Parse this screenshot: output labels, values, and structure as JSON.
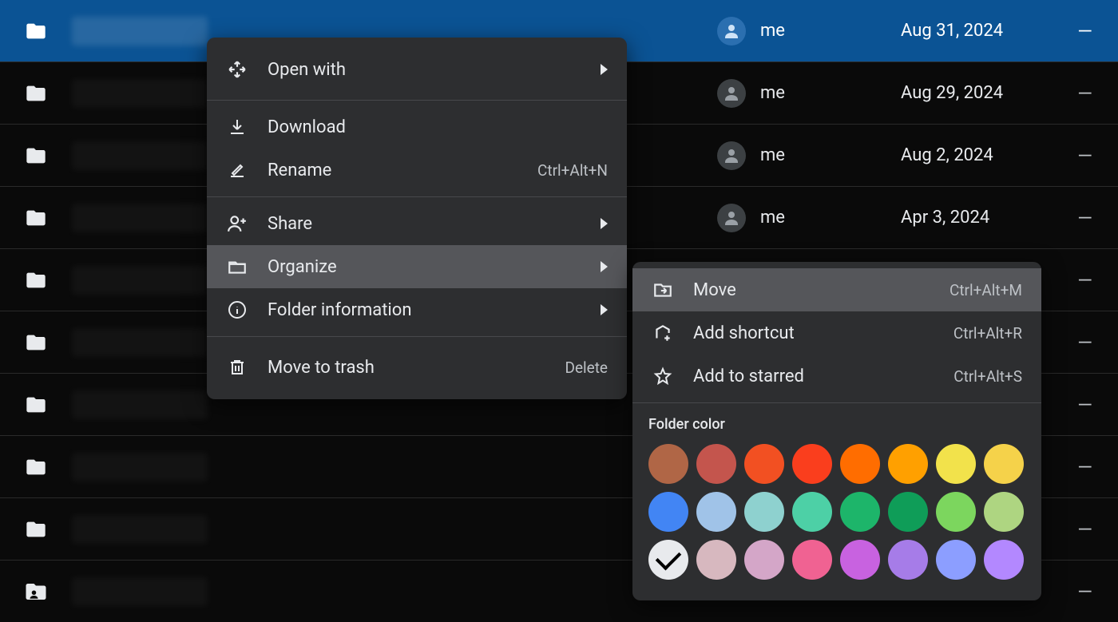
{
  "rows": [
    {
      "owner": "me",
      "date": "Aug 31, 2024",
      "selected": true,
      "shared": false
    },
    {
      "owner": "me",
      "date": "Aug 29, 2024",
      "selected": false,
      "shared": false
    },
    {
      "owner": "me",
      "date": "Aug 2, 2024",
      "selected": false,
      "shared": false
    },
    {
      "owner": "me",
      "date": "Apr 3, 2024",
      "selected": false,
      "shared": false
    },
    {
      "owner": "",
      "date": "",
      "selected": false,
      "shared": false
    },
    {
      "owner": "",
      "date": "",
      "selected": false,
      "shared": false
    },
    {
      "owner": "",
      "date": "",
      "selected": false,
      "shared": false
    },
    {
      "owner": "",
      "date": "",
      "selected": false,
      "shared": false
    },
    {
      "owner": "",
      "date": "",
      "selected": false,
      "shared": false
    },
    {
      "owner": "",
      "date": "",
      "selected": false,
      "shared": true
    }
  ],
  "dash": "—",
  "menu1": {
    "open_with": "Open with",
    "download": "Download",
    "rename": "Rename",
    "rename_shortcut": "Ctrl+Alt+N",
    "share": "Share",
    "organize": "Organize",
    "folder_info": "Folder information",
    "trash": "Move to trash",
    "trash_shortcut": "Delete"
  },
  "menu2": {
    "move": "Move",
    "move_shortcut": "Ctrl+Alt+M",
    "shortcut": "Add shortcut",
    "shortcut_kb": "Ctrl+Alt+R",
    "starred": "Add to starred",
    "starred_kb": "Ctrl+Alt+S",
    "folder_color": "Folder color"
  },
  "colors": [
    {
      "hex": "#b06646",
      "selected": false
    },
    {
      "hex": "#c4554d",
      "selected": false
    },
    {
      "hex": "#f25022",
      "selected": false
    },
    {
      "hex": "#fa3e1d",
      "selected": false
    },
    {
      "hex": "#ff6d00",
      "selected": false
    },
    {
      "hex": "#ffa000",
      "selected": false
    },
    {
      "hex": "#f2e24b",
      "selected": false
    },
    {
      "hex": "#f5d24a",
      "selected": false
    },
    {
      "hex": "#4285f4",
      "selected": false
    },
    {
      "hex": "#a0c3e8",
      "selected": false
    },
    {
      "hex": "#8ed1cf",
      "selected": false
    },
    {
      "hex": "#4dd0a6",
      "selected": false
    },
    {
      "hex": "#1db56a",
      "selected": false
    },
    {
      "hex": "#0f9d58",
      "selected": false
    },
    {
      "hex": "#7cd65e",
      "selected": false
    },
    {
      "hex": "#aed581",
      "selected": false
    },
    {
      "hex": "#e8eaed",
      "selected": true
    },
    {
      "hex": "#d7b8bf",
      "selected": false
    },
    {
      "hex": "#d4a6c8",
      "selected": false
    },
    {
      "hex": "#f06292",
      "selected": false
    },
    {
      "hex": "#c862e0",
      "selected": false
    },
    {
      "hex": "#a67ce8",
      "selected": false
    },
    {
      "hex": "#8c9eff",
      "selected": false
    },
    {
      "hex": "#b388ff",
      "selected": false
    }
  ]
}
